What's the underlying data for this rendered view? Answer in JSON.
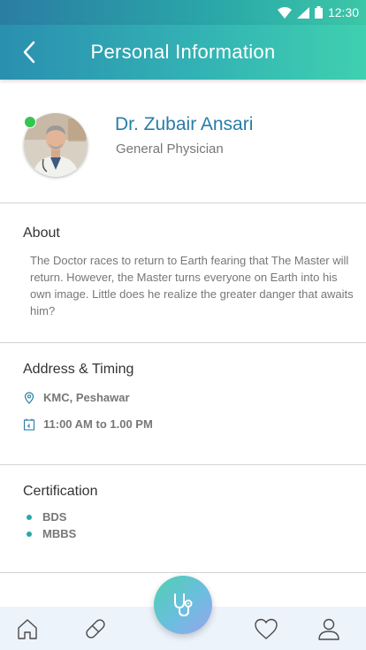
{
  "status_bar": {
    "time": "12:30"
  },
  "header": {
    "title": "Personal Information"
  },
  "profile": {
    "name": "Dr. Zubair Ansari",
    "specialty": "General Physician",
    "online": true
  },
  "about": {
    "title": "About",
    "text": "The Doctor races to return to Earth fearing that The Master will return. However, the Master turns everyone on Earth into his own image. Little does he realize the greater danger that awaits him?"
  },
  "address_timing": {
    "title": "Address & Timing",
    "location": "KMC, Peshawar",
    "timing": "11:00 AM to 1.00 PM"
  },
  "certification": {
    "title": "Certification",
    "items": [
      "BDS",
      "MBBS"
    ]
  },
  "bottom_nav": {
    "items": [
      "home-icon",
      "pill-icon",
      "stethoscope-icon",
      "heart-icon",
      "user-icon"
    ],
    "accent": "#2aa8a8"
  }
}
